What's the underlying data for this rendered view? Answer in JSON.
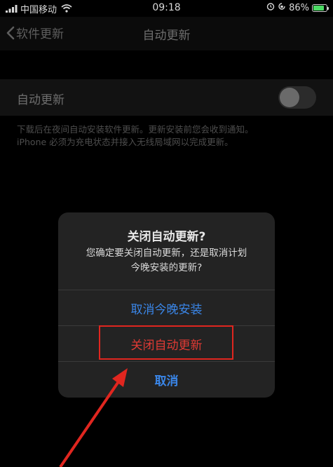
{
  "status_bar": {
    "carrier": "中国移动",
    "time": "09:18",
    "battery_percent": "86%",
    "battery_level": 0.86
  },
  "nav": {
    "back_label": "软件更新",
    "title": "自动更新"
  },
  "settings": {
    "auto_update_label": "自动更新",
    "auto_update_enabled": false,
    "footnote_line1": "下载后在夜间自动安装软件更新。更新安装前您会收到通知。",
    "footnote_line2": "iPhone 必须为充电状态并接入无线局域网以完成更新。"
  },
  "alert": {
    "title": "关闭自动更新?",
    "message_line1": "您确定要关闭自动更新，还是取消计划",
    "message_line2": "今晚安装的更新?",
    "buttons": {
      "cancel_tonight": "取消今晚安装",
      "turn_off": "关闭自动更新",
      "cancel": "取消"
    }
  },
  "colors": {
    "background": "#000000",
    "alert_background": "#232323",
    "action_blue": "#3a86e8",
    "destructive_red": "#e03a34",
    "annotation_red": "#e0261f",
    "battery_green": "#4cd964"
  },
  "icons": [
    "signal-icon",
    "wifi-icon",
    "alarm-icon",
    "orientation-lock-icon",
    "battery-icon",
    "chevron-left-icon"
  ]
}
